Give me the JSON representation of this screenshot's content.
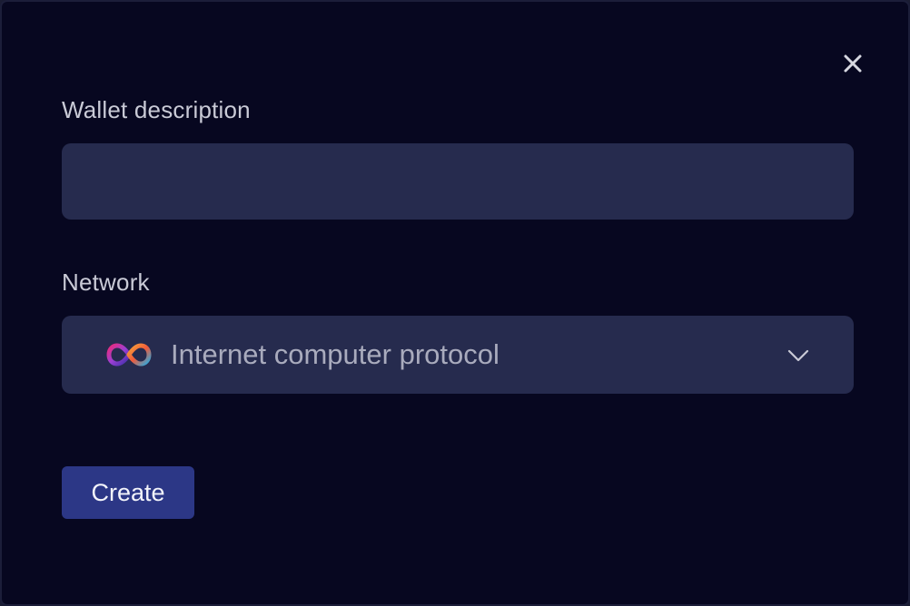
{
  "dialog": {
    "close_icon": "close-icon",
    "wallet_description": {
      "label": "Wallet description",
      "value": "",
      "placeholder": ""
    },
    "network": {
      "label": "Network",
      "selected": "Internet computer protocol",
      "icon": "infinity-logo-icon",
      "dropdown_icon": "chevron-down-icon"
    },
    "create_button": {
      "label": "Create"
    }
  },
  "colors": {
    "background": "#070720",
    "input_background": "#262b4e",
    "button_background": "#2c3786",
    "label_text": "#c9cad6",
    "select_text": "#a9abbd"
  }
}
